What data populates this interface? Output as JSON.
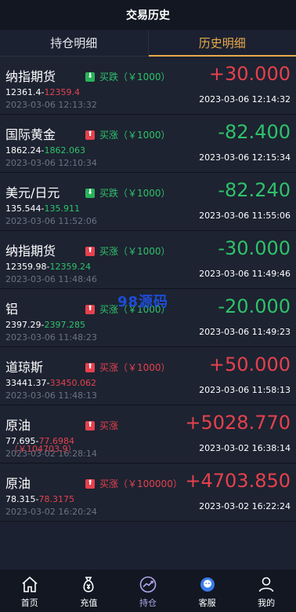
{
  "header": {
    "title": "交易历史"
  },
  "tabs": [
    {
      "label": "持仓明细",
      "active": false
    },
    {
      "label": "历史明细",
      "active": true
    }
  ],
  "trades": [
    {
      "name": "纳指期货",
      "direction": "买跌",
      "direction_dir": "down",
      "direction_color": "green",
      "amount": "（￥1000）",
      "open_price": "12361.4",
      "close_price": "12359.4",
      "close_color": "red",
      "open_time": "2023-03-06 12:13:32",
      "pnl": "+30.000",
      "pnl_color": "red",
      "close_time": "2023-03-06 12:14:32"
    },
    {
      "name": "国际黄金",
      "direction": "买涨",
      "direction_dir": "up",
      "direction_color": "green",
      "amount": "（￥1000）",
      "open_price": "1862.24",
      "close_price": "1862.063",
      "close_color": "green",
      "open_time": "2023-03-06 12:10:34",
      "pnl": "-82.400",
      "pnl_color": "green",
      "close_time": "2023-03-06 12:15:34"
    },
    {
      "name": "美元/日元",
      "direction": "买跌",
      "direction_dir": "down",
      "direction_color": "green",
      "amount": "（￥1000）",
      "open_price": "135.544",
      "close_price": "135.911",
      "close_color": "green",
      "open_time": "2023-03-06 11:52:06",
      "pnl": "-82.240",
      "pnl_color": "green",
      "close_time": "2023-03-06 11:55:06"
    },
    {
      "name": "纳指期货",
      "direction": "买涨",
      "direction_dir": "up",
      "direction_color": "green",
      "amount": "（￥1000）",
      "open_price": "12359.98",
      "close_price": "12359.24",
      "close_color": "green",
      "open_time": "2023-03-06 11:48:46",
      "pnl": "-30.000",
      "pnl_color": "green",
      "close_time": "2023-03-06 11:49:46"
    },
    {
      "name": "铝",
      "direction": "买涨",
      "direction_dir": "up",
      "direction_color": "green",
      "amount": "（￥1000）",
      "open_price": "2397.29",
      "close_price": "2397.285",
      "close_color": "green",
      "open_time": "2023-03-06 11:48:23",
      "pnl": "-20.000",
      "pnl_color": "green",
      "close_time": "2023-03-06 11:49:23"
    },
    {
      "name": "道琼斯",
      "direction": "买涨",
      "direction_dir": "up",
      "direction_color": "red",
      "amount": "（￥1000）",
      "open_price": "33441.37",
      "close_price": "33450.062",
      "close_color": "red",
      "open_time": "2023-03-06 11:48:13",
      "pnl": "+50.000",
      "pnl_color": "red",
      "close_time": "2023-03-06 11:58:13"
    },
    {
      "name": "原油",
      "direction": "买涨",
      "direction_dir": "up",
      "direction_color": "red",
      "amount": "",
      "open_price": "77.695",
      "close_price": "77.6984",
      "close_color": "red",
      "open_time": "2023-03-02 16:28:14",
      "overlay": "（￥104703.9）",
      "pnl": "+5028.770",
      "pnl_color": "red",
      "close_time": "2023-03-02 16:38:14"
    },
    {
      "name": "原油",
      "direction": "买涨",
      "direction_dir": "up",
      "direction_color": "red",
      "amount": "（￥100000）",
      "open_price": "78.315",
      "close_price": "78.3175",
      "close_color": "red",
      "open_time": "2023-03-02 16:20:24",
      "pnl": "+4703.850",
      "pnl_color": "red",
      "close_time": "2023-03-02 16:22:24"
    }
  ],
  "watermark": "98源码",
  "nav": [
    {
      "label": "首页",
      "icon": "home-icon",
      "active": false
    },
    {
      "label": "充值",
      "icon": "money-bag-icon",
      "active": false
    },
    {
      "label": "持仓",
      "icon": "chart-icon",
      "active": true
    },
    {
      "label": "客服",
      "icon": "support-icon",
      "active": false
    },
    {
      "label": "我的",
      "icon": "user-icon",
      "active": false
    }
  ],
  "colors": {
    "red": "#e5414d",
    "green": "#2fc26a",
    "accent": "#e8a94a",
    "nav_active": "#b6a7f0"
  }
}
